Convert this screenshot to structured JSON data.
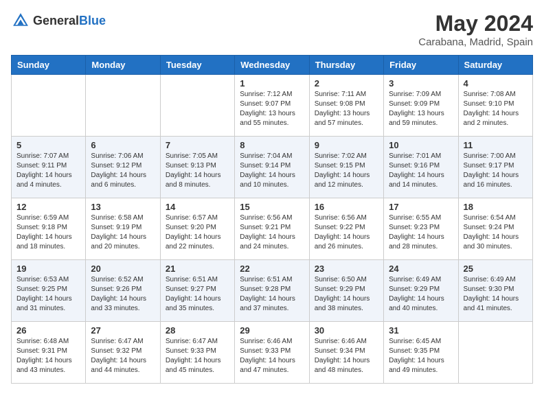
{
  "header": {
    "logo_general": "General",
    "logo_blue": "Blue",
    "month": "May 2024",
    "location": "Carabana, Madrid, Spain"
  },
  "calendar": {
    "days_of_week": [
      "Sunday",
      "Monday",
      "Tuesday",
      "Wednesday",
      "Thursday",
      "Friday",
      "Saturday"
    ],
    "weeks": [
      [
        {
          "day": "",
          "sunrise": "",
          "sunset": "",
          "daylight": ""
        },
        {
          "day": "",
          "sunrise": "",
          "sunset": "",
          "daylight": ""
        },
        {
          "day": "",
          "sunrise": "",
          "sunset": "",
          "daylight": ""
        },
        {
          "day": "1",
          "sunrise": "Sunrise: 7:12 AM",
          "sunset": "Sunset: 9:07 PM",
          "daylight": "Daylight: 13 hours and 55 minutes."
        },
        {
          "day": "2",
          "sunrise": "Sunrise: 7:11 AM",
          "sunset": "Sunset: 9:08 PM",
          "daylight": "Daylight: 13 hours and 57 minutes."
        },
        {
          "day": "3",
          "sunrise": "Sunrise: 7:09 AM",
          "sunset": "Sunset: 9:09 PM",
          "daylight": "Daylight: 13 hours and 59 minutes."
        },
        {
          "day": "4",
          "sunrise": "Sunrise: 7:08 AM",
          "sunset": "Sunset: 9:10 PM",
          "daylight": "Daylight: 14 hours and 2 minutes."
        }
      ],
      [
        {
          "day": "5",
          "sunrise": "Sunrise: 7:07 AM",
          "sunset": "Sunset: 9:11 PM",
          "daylight": "Daylight: 14 hours and 4 minutes."
        },
        {
          "day": "6",
          "sunrise": "Sunrise: 7:06 AM",
          "sunset": "Sunset: 9:12 PM",
          "daylight": "Daylight: 14 hours and 6 minutes."
        },
        {
          "day": "7",
          "sunrise": "Sunrise: 7:05 AM",
          "sunset": "Sunset: 9:13 PM",
          "daylight": "Daylight: 14 hours and 8 minutes."
        },
        {
          "day": "8",
          "sunrise": "Sunrise: 7:04 AM",
          "sunset": "Sunset: 9:14 PM",
          "daylight": "Daylight: 14 hours and 10 minutes."
        },
        {
          "day": "9",
          "sunrise": "Sunrise: 7:02 AM",
          "sunset": "Sunset: 9:15 PM",
          "daylight": "Daylight: 14 hours and 12 minutes."
        },
        {
          "day": "10",
          "sunrise": "Sunrise: 7:01 AM",
          "sunset": "Sunset: 9:16 PM",
          "daylight": "Daylight: 14 hours and 14 minutes."
        },
        {
          "day": "11",
          "sunrise": "Sunrise: 7:00 AM",
          "sunset": "Sunset: 9:17 PM",
          "daylight": "Daylight: 14 hours and 16 minutes."
        }
      ],
      [
        {
          "day": "12",
          "sunrise": "Sunrise: 6:59 AM",
          "sunset": "Sunset: 9:18 PM",
          "daylight": "Daylight: 14 hours and 18 minutes."
        },
        {
          "day": "13",
          "sunrise": "Sunrise: 6:58 AM",
          "sunset": "Sunset: 9:19 PM",
          "daylight": "Daylight: 14 hours and 20 minutes."
        },
        {
          "day": "14",
          "sunrise": "Sunrise: 6:57 AM",
          "sunset": "Sunset: 9:20 PM",
          "daylight": "Daylight: 14 hours and 22 minutes."
        },
        {
          "day": "15",
          "sunrise": "Sunrise: 6:56 AM",
          "sunset": "Sunset: 9:21 PM",
          "daylight": "Daylight: 14 hours and 24 minutes."
        },
        {
          "day": "16",
          "sunrise": "Sunrise: 6:56 AM",
          "sunset": "Sunset: 9:22 PM",
          "daylight": "Daylight: 14 hours and 26 minutes."
        },
        {
          "day": "17",
          "sunrise": "Sunrise: 6:55 AM",
          "sunset": "Sunset: 9:23 PM",
          "daylight": "Daylight: 14 hours and 28 minutes."
        },
        {
          "day": "18",
          "sunrise": "Sunrise: 6:54 AM",
          "sunset": "Sunset: 9:24 PM",
          "daylight": "Daylight: 14 hours and 30 minutes."
        }
      ],
      [
        {
          "day": "19",
          "sunrise": "Sunrise: 6:53 AM",
          "sunset": "Sunset: 9:25 PM",
          "daylight": "Daylight: 14 hours and 31 minutes."
        },
        {
          "day": "20",
          "sunrise": "Sunrise: 6:52 AM",
          "sunset": "Sunset: 9:26 PM",
          "daylight": "Daylight: 14 hours and 33 minutes."
        },
        {
          "day": "21",
          "sunrise": "Sunrise: 6:51 AM",
          "sunset": "Sunset: 9:27 PM",
          "daylight": "Daylight: 14 hours and 35 minutes."
        },
        {
          "day": "22",
          "sunrise": "Sunrise: 6:51 AM",
          "sunset": "Sunset: 9:28 PM",
          "daylight": "Daylight: 14 hours and 37 minutes."
        },
        {
          "day": "23",
          "sunrise": "Sunrise: 6:50 AM",
          "sunset": "Sunset: 9:29 PM",
          "daylight": "Daylight: 14 hours and 38 minutes."
        },
        {
          "day": "24",
          "sunrise": "Sunrise: 6:49 AM",
          "sunset": "Sunset: 9:29 PM",
          "daylight": "Daylight: 14 hours and 40 minutes."
        },
        {
          "day": "25",
          "sunrise": "Sunrise: 6:49 AM",
          "sunset": "Sunset: 9:30 PM",
          "daylight": "Daylight: 14 hours and 41 minutes."
        }
      ],
      [
        {
          "day": "26",
          "sunrise": "Sunrise: 6:48 AM",
          "sunset": "Sunset: 9:31 PM",
          "daylight": "Daylight: 14 hours and 43 minutes."
        },
        {
          "day": "27",
          "sunrise": "Sunrise: 6:47 AM",
          "sunset": "Sunset: 9:32 PM",
          "daylight": "Daylight: 14 hours and 44 minutes."
        },
        {
          "day": "28",
          "sunrise": "Sunrise: 6:47 AM",
          "sunset": "Sunset: 9:33 PM",
          "daylight": "Daylight: 14 hours and 45 minutes."
        },
        {
          "day": "29",
          "sunrise": "Sunrise: 6:46 AM",
          "sunset": "Sunset: 9:33 PM",
          "daylight": "Daylight: 14 hours and 47 minutes."
        },
        {
          "day": "30",
          "sunrise": "Sunrise: 6:46 AM",
          "sunset": "Sunset: 9:34 PM",
          "daylight": "Daylight: 14 hours and 48 minutes."
        },
        {
          "day": "31",
          "sunrise": "Sunrise: 6:45 AM",
          "sunset": "Sunset: 9:35 PM",
          "daylight": "Daylight: 14 hours and 49 minutes."
        },
        {
          "day": "",
          "sunrise": "",
          "sunset": "",
          "daylight": ""
        }
      ]
    ]
  }
}
